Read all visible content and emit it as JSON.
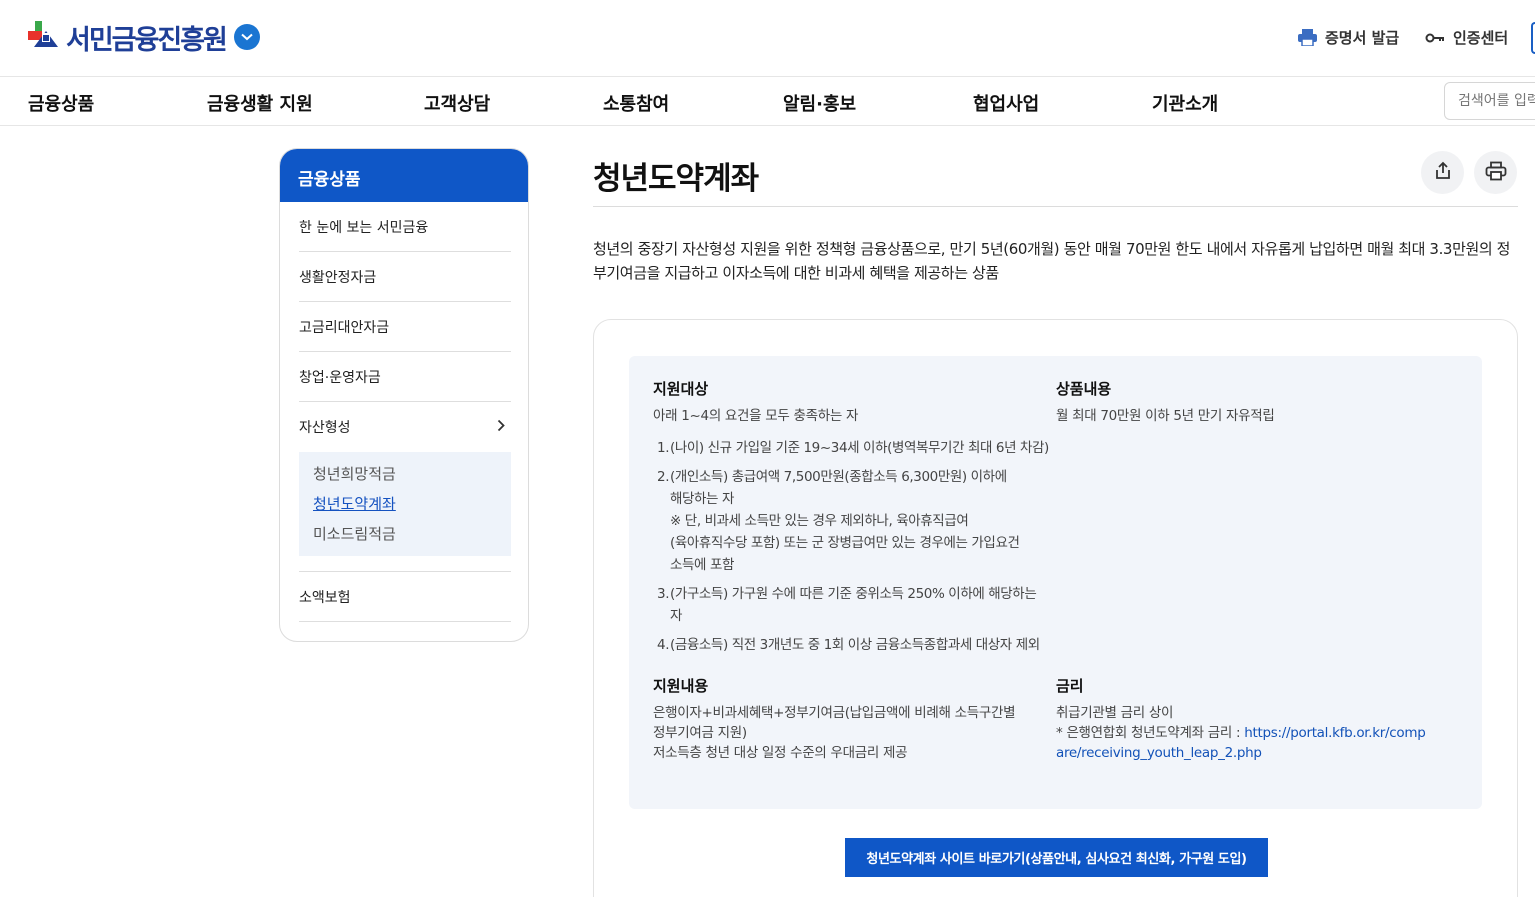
{
  "header": {
    "logo_text": "서민금융진흥원",
    "cert_label": "증명서 발급",
    "auth_label": "인증센터"
  },
  "gnb": {
    "items": [
      "금융상품",
      "금융생활 지원",
      "고객상담",
      "소통참여",
      "알림·홍보",
      "협업사업",
      "기관소개"
    ],
    "search_placeholder": "검색어를 입력"
  },
  "lnb": {
    "title": "금융상품",
    "items": [
      "한 눈에 보는 서민금융",
      "생활안정자금",
      "고금리대안자금",
      "창업·운영자금",
      "자산형성",
      "소액보험"
    ],
    "sub_items": [
      "청년희망적금",
      "청년도약계좌",
      "미소드림적금"
    ],
    "active_sub": "청년도약계좌"
  },
  "content": {
    "title": "청년도약계좌",
    "intro": "청년의 중장기 자산형성 지원을 위한 정책형 금융상품으로, 만기 5년(60개월) 동안 매월 70만원 한도 내에서 자유롭게 납입하면 매월 최대 3.3만원의 정부기여금을 지급하고 이자소득에 대한 비과세 혜택을 제공하는 상품",
    "target": {
      "heading": "지원대상",
      "summary": "아래 1~4의 요건을 모두 충족하는 자",
      "items": [
        {
          "num": "1.",
          "lines": [
            "(나이) 신규 가입일 기준 19~34세 이하(병역복무기간 최대 6년 차감)"
          ]
        },
        {
          "num": "2.",
          "lines": [
            "(개인소득) 총급여액 7,500만원(종합소득 6,300만원) 이하에",
            "해당하는 자",
            "※ 단, 비과세 소득만 있는 경우 제외하나, 육아휴직급여",
            "(육아휴직수당 포함) 또는 군 장병급여만 있는 경우에는 가입요건",
            "소득에 포함"
          ]
        },
        {
          "num": "3.",
          "lines": [
            "(가구소득) 가구원 수에 따른 기준 중위소득 250% 이하에 해당하는",
            "자"
          ]
        },
        {
          "num": "4.",
          "lines": [
            "(금융소득) 직전 3개년도 중 1회 이상 금융소득종합과세 대상자 제외"
          ]
        }
      ]
    },
    "product": {
      "heading": "상품내용",
      "text": "월 최대 70만원 이하 5년 만기 자유적립"
    },
    "support": {
      "heading": "지원내용",
      "lines": [
        "은행이자+비과세혜택+정부기여금(납입금액에 비례해 소득구간별",
        "정부기여금 지원)",
        "저소득층 청년 대상 일정 수준의 우대금리 제공"
      ]
    },
    "rate": {
      "heading": "금리",
      "line1": "취급기관별 금리 상이",
      "line2_prefix": "* 은행연합회 청년도약계좌 금리 : ",
      "link_part1": "https://portal.kfb.or.kr/comp",
      "link_part2": "are/receiving_youth_leap_2.php"
    },
    "cta_label": "청년도약계좌 사이트 바로가기(상품안내, 심사요건 최신화, 가구원 도입)"
  },
  "colors": {
    "primary": "#0f57c7",
    "logo_navy": "#1f3f97",
    "info_bg": "#f2f5fa",
    "link": "#1352b8"
  },
  "icons": [
    "logo-mark-icon",
    "chevron-down-icon",
    "printer-icon",
    "key-icon",
    "chevron-right-icon",
    "share-icon",
    "print-icon"
  ]
}
